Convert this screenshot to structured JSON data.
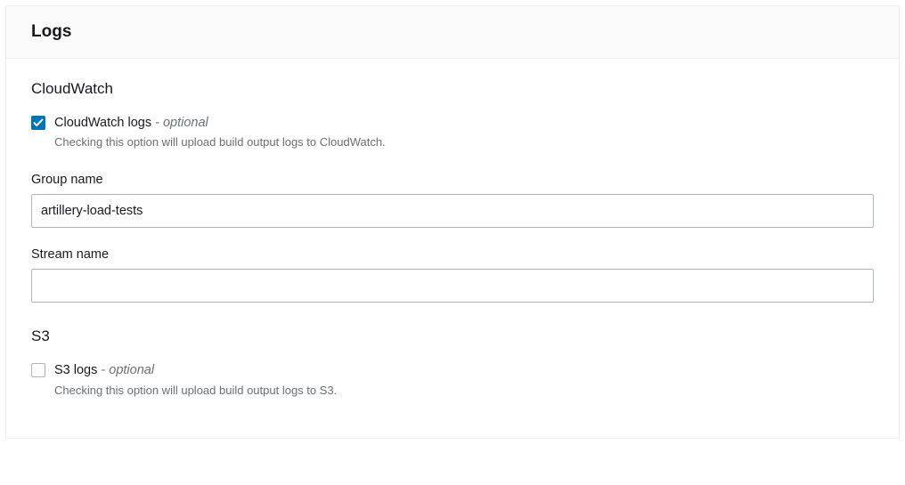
{
  "panel": {
    "title": "Logs"
  },
  "cloudwatch": {
    "heading": "CloudWatch",
    "checkbox_label": "CloudWatch logs",
    "optional_suffix": " - optional",
    "checkbox_description": "Checking this option will upload build output logs to CloudWatch.",
    "group_name_label": "Group name",
    "group_name_value": "artillery-load-tests",
    "stream_name_label": "Stream name",
    "stream_name_value": ""
  },
  "s3": {
    "heading": "S3",
    "checkbox_label": "S3 logs",
    "optional_suffix": " - optional",
    "checkbox_description": "Checking this option will upload build output logs to S3."
  }
}
